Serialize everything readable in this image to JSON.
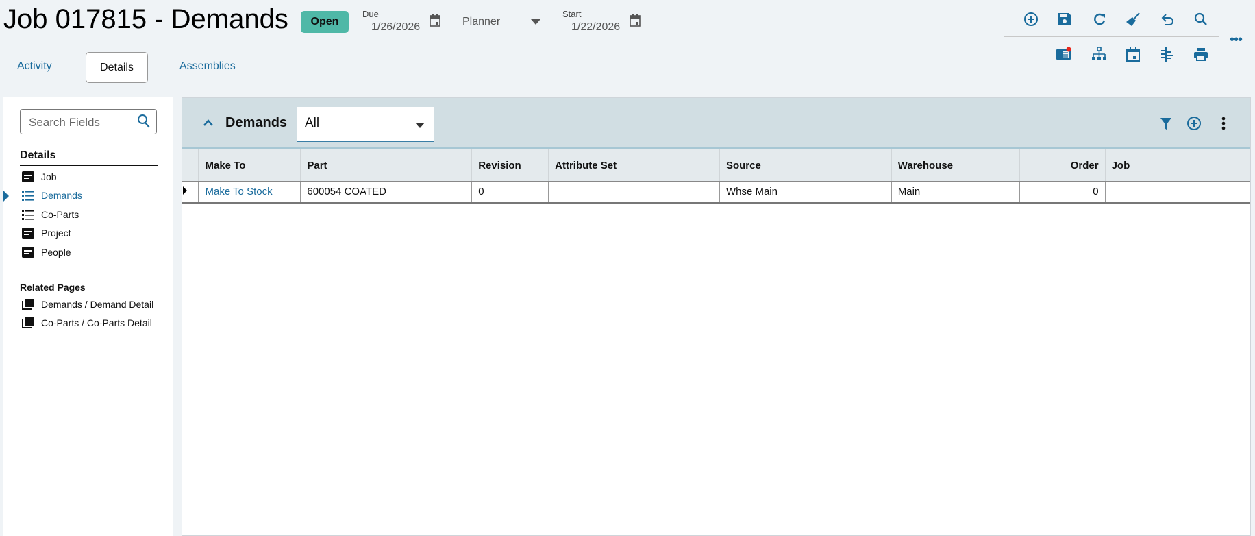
{
  "header": {
    "title": "Job 017815 - Demands",
    "status": "Open",
    "due_label": "Due",
    "due_value": "1/26/2026",
    "planner": "Planner",
    "start_label": "Start",
    "start_value": "1/22/2026"
  },
  "tabs": [
    {
      "label": "Activity"
    },
    {
      "label": "Details"
    },
    {
      "label": "Assemblies"
    }
  ],
  "toolbar": {
    "row1": [
      "add-icon",
      "save-icon",
      "refresh-icon",
      "clear-icon",
      "undo-icon",
      "search-icon"
    ],
    "row2": [
      "notes-icon",
      "tree-icon",
      "calendar-icon",
      "split-icon",
      "print-icon"
    ],
    "notification_color": "#e8261b"
  },
  "sidebar": {
    "search_placeholder": "Search Fields",
    "details_heading": "Details",
    "items": [
      {
        "label": "Job"
      },
      {
        "label": "Demands"
      },
      {
        "label": "Co-Parts"
      },
      {
        "label": "Project"
      },
      {
        "label": "People"
      }
    ],
    "related_heading": "Related Pages",
    "related": [
      {
        "label": "Demands / Demand Detail"
      },
      {
        "label": "Co-Parts / Co-Parts Detail"
      }
    ]
  },
  "panel": {
    "title": "Demands",
    "filter_value": "All"
  },
  "grid": {
    "columns": [
      "Make To",
      "Part",
      "Revision",
      "Attribute Set",
      "Source",
      "Warehouse",
      "Order",
      "Job"
    ],
    "rows": [
      [
        "Make To Stock",
        "600054 COATED",
        "0",
        "",
        "Whse Main",
        "Main",
        "0",
        ""
      ]
    ]
  },
  "colors": {
    "accent": "#1a6b9c",
    "badge": "#4fb8a7",
    "band": "#d1dee3"
  }
}
